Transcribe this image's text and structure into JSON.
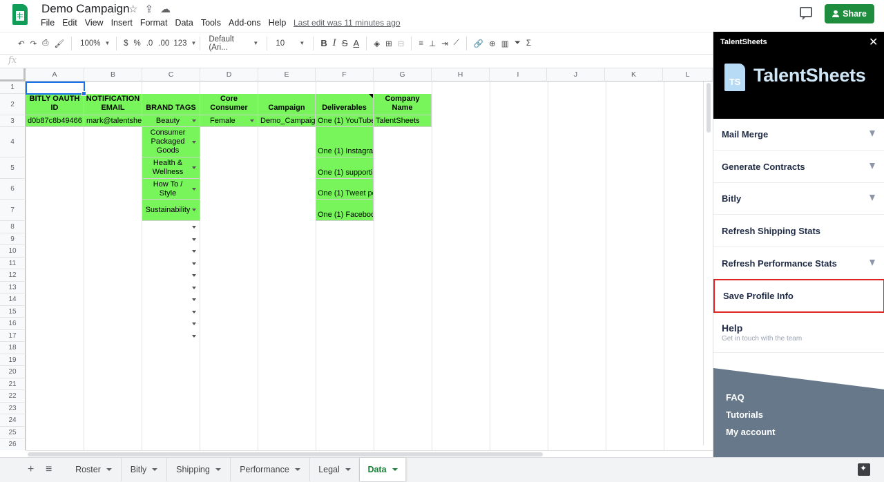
{
  "app": {
    "doc_title": "Demo Campaign",
    "menu": [
      "File",
      "Edit",
      "View",
      "Insert",
      "Format",
      "Data",
      "Tools",
      "Add-ons",
      "Help"
    ],
    "last_edit": "Last edit was 11 minutes ago",
    "share_label": "Share"
  },
  "toolbar": {
    "zoom": "100%",
    "currency": "$",
    "percent": "%",
    "dec_less": ".0",
    "dec_more": ".00",
    "more_formats": "123",
    "font": "Default (Ari...",
    "font_size": "10",
    "bold": "B",
    "italic": "I",
    "strike": "S",
    "text_color": "A",
    "sum": "Σ"
  },
  "formula_bar": {
    "fx": "fx",
    "value": ""
  },
  "grid": {
    "columns": [
      "A",
      "B",
      "C",
      "D",
      "E",
      "F",
      "G",
      "H",
      "I",
      "J",
      "K",
      "L"
    ],
    "rows": [
      "1",
      "2",
      "3",
      "4",
      "5",
      "6",
      "7",
      "8",
      "9",
      "10",
      "11",
      "12",
      "13",
      "14",
      "15",
      "16",
      "17",
      "18",
      "19",
      "20",
      "21",
      "22",
      "23",
      "24",
      "25",
      "26"
    ],
    "headers": {
      "a": "BITLY OAUTH ID",
      "b": "NOTIFICATION EMAIL",
      "c": "BRAND TAGS",
      "d": "Core Consumer",
      "e": "Campaign",
      "f": "Deliverables",
      "g": "Company Name"
    },
    "row3": {
      "a": "d0b87c8b49466",
      "b": "mark@talentshe",
      "c": "Beauty",
      "d": "Female",
      "e": "Demo_Campaign",
      "f": "One (1) YouTube",
      "g": "TalentSheets"
    },
    "brand_tags": [
      "Consumer Packaged Goods",
      "Health & Wellness",
      "How To / Style",
      "Sustainability"
    ],
    "deliverables": [
      "One (1) Instagra",
      "One (1) supporti",
      "One (1) Tweet po",
      "One (1) Faceboo"
    ],
    "highlight_color": "#77F55B"
  },
  "sheets": {
    "tabs": [
      "Roster",
      "Bitly",
      "Shipping",
      "Performance",
      "Legal",
      "Data"
    ],
    "active": "Data"
  },
  "panel": {
    "title": "TalentSheets",
    "logo_mark": "TS",
    "brand": "TalentSheets",
    "items": [
      "Mail Merge",
      "Generate Contracts",
      "Bitly",
      "Refresh Shipping Stats",
      "Refresh Performance Stats",
      "Save Profile Info"
    ],
    "help_title": "Help",
    "help_sub": "Get in touch with the team",
    "links": [
      "FAQ",
      "Tutorials",
      "My account"
    ],
    "accent": "#667889",
    "highlight_border": "#E02424"
  }
}
